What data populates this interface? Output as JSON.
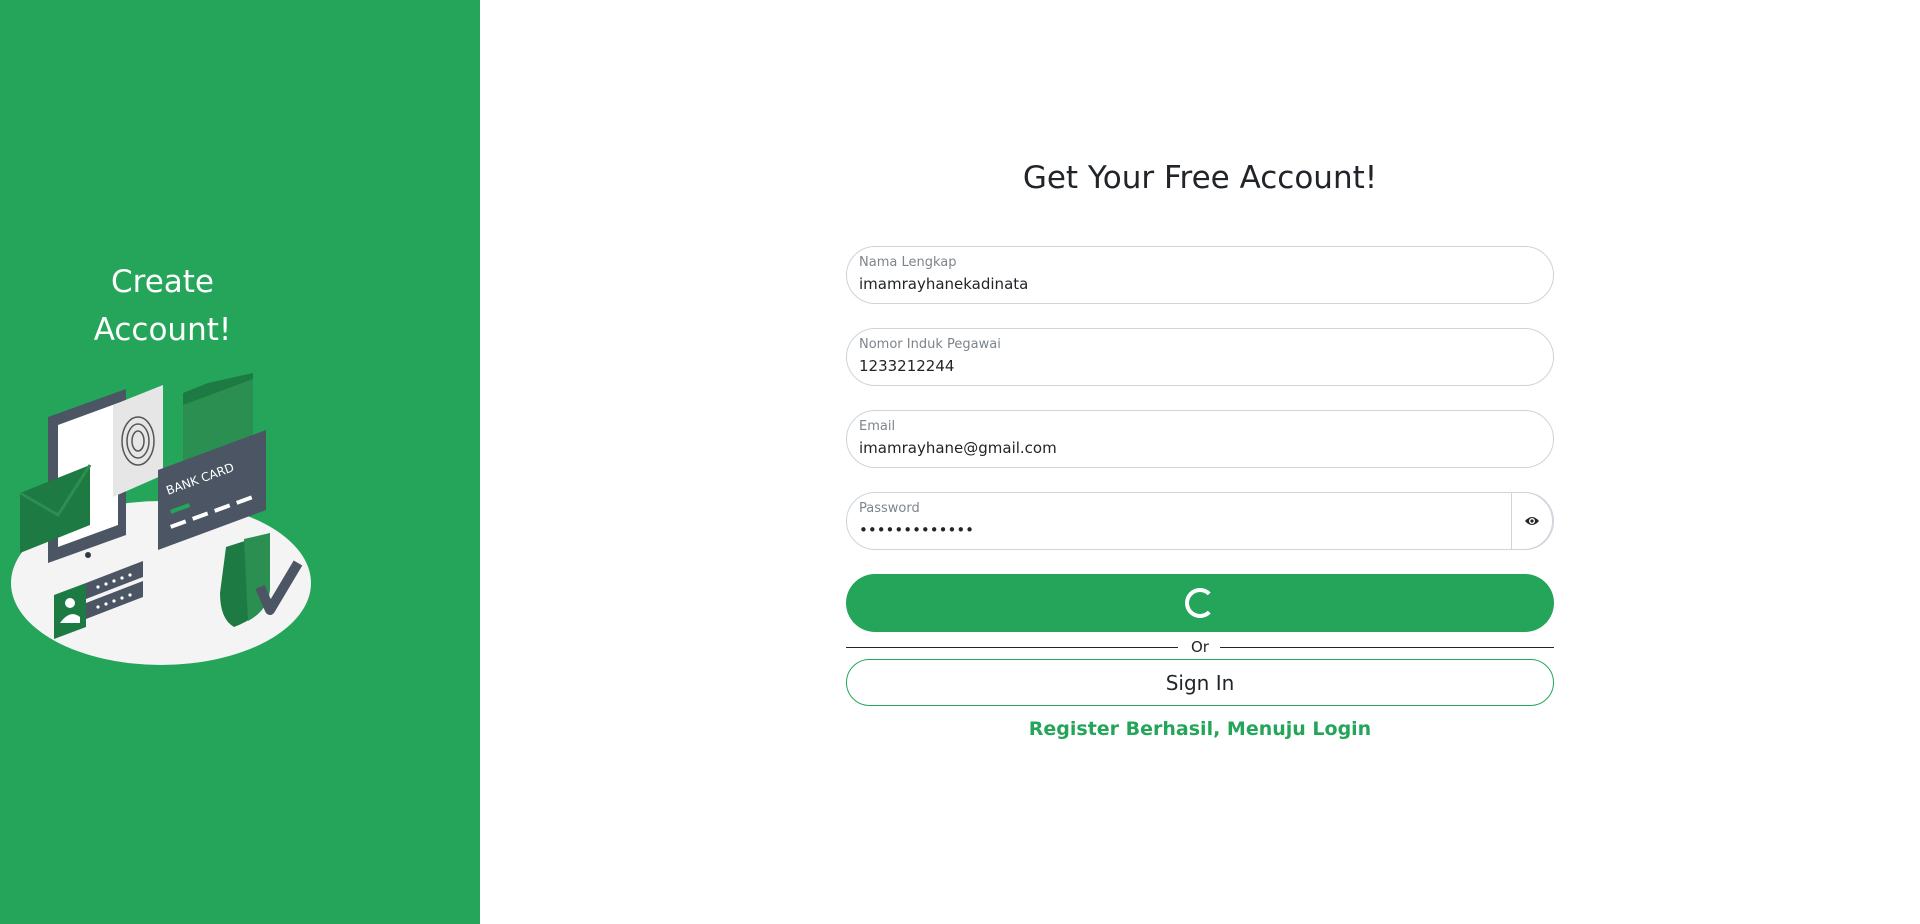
{
  "sidebar": {
    "title_line1": "Create",
    "title_line2": "Account!",
    "illustration": {
      "icon_names": [
        "tablet-icon",
        "fingerprint-icon",
        "folder-icon",
        "bank-card-icon",
        "envelope-icon",
        "shield-check-icon",
        "user-card-icon",
        "password-field-icon"
      ],
      "card_label": "BANK CARD"
    }
  },
  "main": {
    "heading": "Get Your Free Account!",
    "fields": {
      "name": {
        "label": "Nama Lengkap",
        "value": "imamrayhanekadinata"
      },
      "nip": {
        "label": "Nomor Induk Pegawai",
        "value": "1233212244"
      },
      "email": {
        "label": "Email",
        "value": "imamrayhane@gmail.com"
      },
      "password": {
        "label": "Password",
        "value": "•••••••••••••"
      }
    },
    "divider_text": "Or",
    "signin_label": "Sign In",
    "status_message": "Register Berhasil, Menuju Login"
  },
  "colors": {
    "brand": "#25a55a",
    "text": "#212529",
    "border": "#ced4da"
  }
}
